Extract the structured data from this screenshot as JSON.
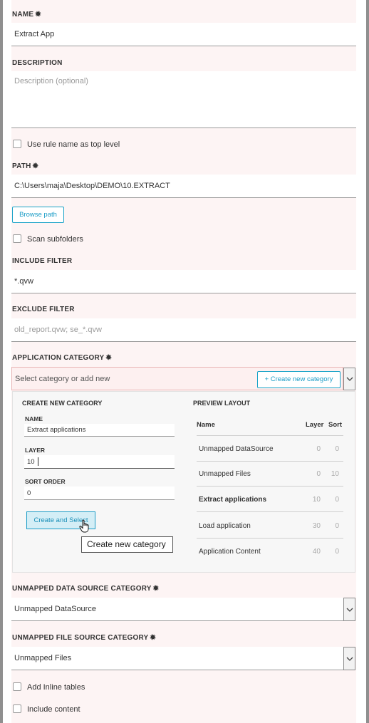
{
  "form": {
    "name": {
      "label": "NAME",
      "value": "Extract App"
    },
    "description": {
      "label": "DESCRIPTION",
      "placeholder": "Description (optional)"
    },
    "use_rule_name": {
      "label": "Use rule name as top level"
    },
    "path": {
      "label": "PATH",
      "value": "C:\\Users\\maja\\Desktop\\DEMO\\10.EXTRACT"
    },
    "browse_path": {
      "label": "Browse path"
    },
    "scan_subfolders": {
      "label": "Scan subfolders"
    },
    "include_filter": {
      "label": "INCLUDE FILTER",
      "value": "*.qvw"
    },
    "exclude_filter": {
      "label": "EXCLUDE FILTER",
      "placeholder": "old_report.qvw; se_*.qvw"
    },
    "app_category": {
      "label": "APPLICATION CATEGORY",
      "placeholder": "Select category or add new",
      "create_button": "+ Create new category"
    },
    "create_new_category": {
      "title": "CREATE NEW CATEGORY",
      "name_label": "NAME",
      "name_value": "Extract applications",
      "layer_label": "LAYER",
      "layer_value": "10",
      "sort_label": "SORT ORDER",
      "sort_value": "0",
      "submit_label": "Create and Select",
      "tooltip": "Create new category"
    },
    "preview_layout": {
      "title": "PREVIEW LAYOUT",
      "headers": {
        "name": "Name",
        "layer": "Layer",
        "sort": "Sort"
      },
      "rows": [
        {
          "name": "Unmapped DataSource",
          "layer": "0",
          "sort": "0"
        },
        {
          "name": "Unmapped Files",
          "layer": "0",
          "sort": "10"
        },
        {
          "name": "Extract applications",
          "layer": "10",
          "sort": "0"
        },
        {
          "name": "Load application",
          "layer": "30",
          "sort": "0"
        },
        {
          "name": "Application Content",
          "layer": "40",
          "sort": "0"
        }
      ]
    },
    "unmapped_data_source": {
      "label": "UNMAPPED DATA SOURCE CATEGORY",
      "value": "Unmapped DataSource"
    },
    "unmapped_file_source": {
      "label": "UNMAPPED FILE SOURCE CATEGORY",
      "value": "Unmapped Files"
    },
    "add_inline_tables": {
      "label": "Add Inline tables"
    },
    "include_content": {
      "label": "Include content"
    },
    "required_marker": "✹"
  },
  "colors": {
    "accent": "#1a9cc6",
    "form_bg": "#fdf4f4",
    "frame": "#8f8f8f"
  }
}
